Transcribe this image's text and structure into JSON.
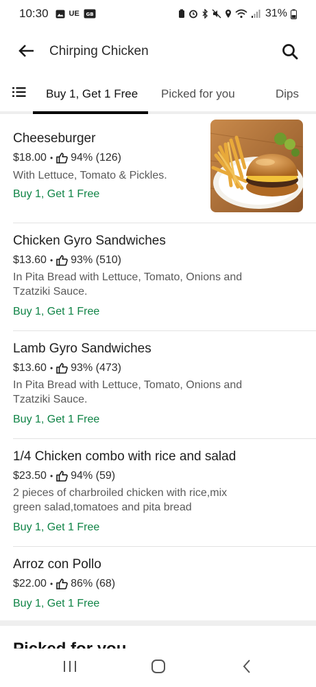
{
  "status_bar": {
    "time": "10:30",
    "battery": "31%",
    "left_icons": [
      "image-icon",
      "ue-icon",
      "sim-badge-icon"
    ],
    "right_icons": [
      "battery-saver-icon",
      "alarm-icon",
      "bluetooth-icon",
      "mute-icon",
      "location-icon",
      "wifi-icon",
      "signal-icon",
      "battery-icon"
    ],
    "ue_label": "UE",
    "sim_label": "GB"
  },
  "header": {
    "title": "Chirping Chicken",
    "back_icon": "arrow-left-icon",
    "search_icon": "search-icon"
  },
  "tabs": {
    "menu_icon": "list-icon",
    "items": [
      {
        "label": "Buy 1, Get 1 Free",
        "active": true
      },
      {
        "label": "Picked for you",
        "active": false
      },
      {
        "label": "Dips",
        "active": false
      }
    ]
  },
  "menu_items": [
    {
      "name": "Cheeseburger",
      "price": "$18.00",
      "rating": "94% (126)",
      "description": "With Lettuce, Tomato & Pickles.",
      "promo": "Buy 1, Get 1 Free",
      "has_photo": true
    },
    {
      "name": "Chicken Gyro Sandwiches",
      "price": "$13.60",
      "rating": "93% (510)",
      "description": "In Pita Bread with Lettuce, Tomato, Onions and Tzatziki Sauce.",
      "promo": "Buy 1, Get 1 Free"
    },
    {
      "name": "Lamb Gyro Sandwiches",
      "price": "$13.60",
      "rating": "93% (473)",
      "description": "In Pita Bread with Lettuce, Tomato, Onions and Tzatziki Sauce.",
      "promo": "Buy 1, Get 1 Free"
    },
    {
      "name": "1/4 Chicken combo with rice and salad",
      "price": "$23.50",
      "rating": "94% (59)",
      "description": "2 pieces of charbroiled chicken with rice,mix green salad,tomatoes and pita bread",
      "promo": "Buy 1, Get 1 Free"
    },
    {
      "name": "Arroz con Pollo",
      "price": "$22.00",
      "rating": "86% (68)",
      "description": "",
      "promo": "Buy 1, Get 1 Free"
    }
  ],
  "next_section_heading": "Picked for you",
  "meta_separator": "•",
  "nav_bar": {
    "recents_icon": "recents-icon",
    "home_icon": "home-icon",
    "back_icon": "back-chevron-icon"
  },
  "colors": {
    "promo": "#0e8345",
    "tab_indicator": "#000000",
    "divider": "#e2e2e2"
  }
}
